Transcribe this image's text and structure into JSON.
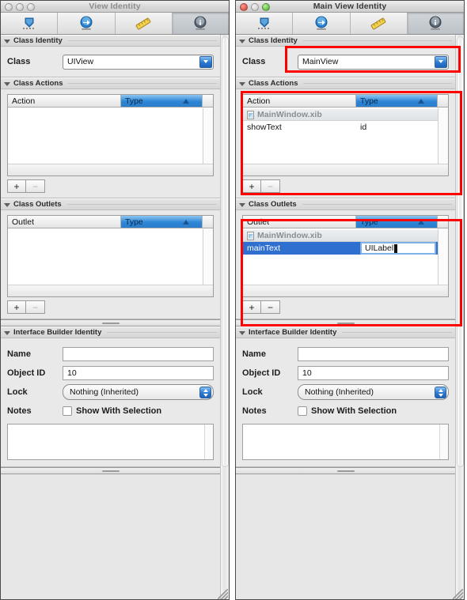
{
  "windows": [
    {
      "id": "left",
      "title": "View Identity",
      "active": false,
      "toolbar": [
        {
          "name": "attributes-inspector-icon",
          "label": "Attributes"
        },
        {
          "name": "connections-inspector-icon",
          "label": "Connections"
        },
        {
          "name": "size-inspector-icon",
          "label": "Size"
        },
        {
          "name": "identity-inspector-icon",
          "label": "Identity",
          "selected": true
        }
      ],
      "class_identity": {
        "section_title": "Class Identity",
        "field_label": "Class",
        "class_value": "UIView"
      },
      "class_actions": {
        "section_title": "Class Actions",
        "col_name": "Action",
        "col_type": "Type",
        "rows": [],
        "add_label": "+",
        "remove_label": "−",
        "add_enabled": true,
        "remove_enabled": false
      },
      "class_outlets": {
        "section_title": "Class Outlets",
        "col_name": "Outlet",
        "col_type": "Type",
        "rows": [],
        "add_label": "+",
        "remove_label": "−",
        "add_enabled": true,
        "remove_enabled": false
      },
      "ib_identity": {
        "section_title": "Interface Builder Identity",
        "name_label": "Name",
        "name_value": "",
        "object_id_label": "Object ID",
        "object_id_value": "10",
        "lock_label": "Lock",
        "lock_value": "Nothing (Inherited)",
        "notes_label": "Notes",
        "show_with_selection_label": "Show With Selection",
        "show_with_selection_checked": false,
        "notes_value": ""
      }
    },
    {
      "id": "right",
      "title": "Main View Identity",
      "active": true,
      "toolbar": [
        {
          "name": "attributes-inspector-icon",
          "label": "Attributes"
        },
        {
          "name": "connections-inspector-icon",
          "label": "Connections"
        },
        {
          "name": "size-inspector-icon",
          "label": "Size"
        },
        {
          "name": "identity-inspector-icon",
          "label": "Identity",
          "selected": true
        }
      ],
      "class_identity": {
        "section_title": "Class Identity",
        "field_label": "Class",
        "class_value": "MainView"
      },
      "class_actions": {
        "section_title": "Class Actions",
        "col_name": "Action",
        "col_type": "Type",
        "group_row": "MainWindow.xib",
        "rows": [
          {
            "name": "showText",
            "type": "id",
            "selected": false
          }
        ],
        "add_label": "+",
        "remove_label": "−",
        "add_enabled": true,
        "remove_enabled": false
      },
      "class_outlets": {
        "section_title": "Class Outlets",
        "col_name": "Outlet",
        "col_type": "Type",
        "group_row": "MainWindow.xib",
        "rows": [
          {
            "name": "mainText",
            "type": "UILabel",
            "selected": true,
            "editing": true
          }
        ],
        "add_label": "+",
        "remove_label": "−",
        "add_enabled": true,
        "remove_enabled": true
      },
      "ib_identity": {
        "section_title": "Interface Builder Identity",
        "name_label": "Name",
        "name_value": "",
        "object_id_label": "Object ID",
        "object_id_value": "10",
        "lock_label": "Lock",
        "lock_value": "Nothing (Inherited)",
        "notes_label": "Notes",
        "show_with_selection_label": "Show With Selection",
        "show_with_selection_checked": false,
        "notes_value": ""
      }
    }
  ],
  "annotations": {
    "color": "#ff0000",
    "regions": [
      "class-identity-field",
      "class-actions-section",
      "class-outlets-section"
    ]
  }
}
